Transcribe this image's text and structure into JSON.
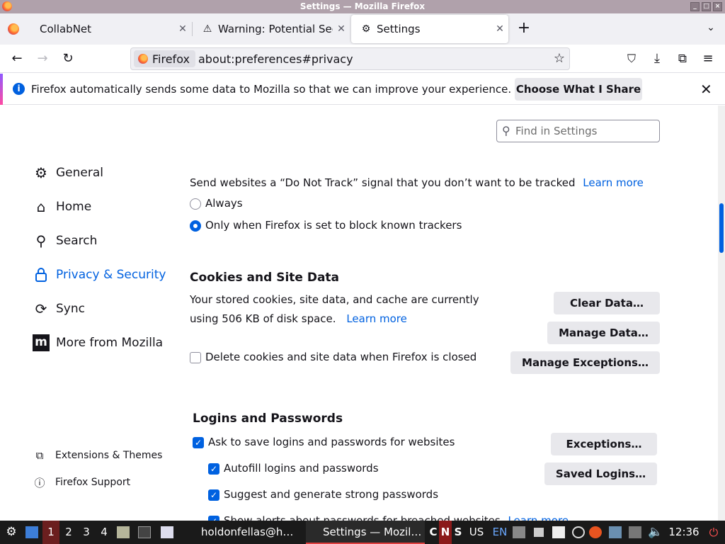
{
  "window": {
    "title": "Settings — Mozilla Firefox"
  },
  "tabs": [
    {
      "label": "CollabNet"
    },
    {
      "label": "Warning: Potential Sec"
    },
    {
      "label": "Settings"
    }
  ],
  "navbar": {
    "identity": "Firefox",
    "url": "about:preferences#privacy"
  },
  "notification": {
    "message": "Firefox automatically sends some data to Mozilla so that we can improve your experience.",
    "button": "Choose What I Share"
  },
  "search": {
    "placeholder": "Find in Settings"
  },
  "sidebar": {
    "items": [
      {
        "label": "General",
        "icon": "gear-icon"
      },
      {
        "label": "Home",
        "icon": "home-icon"
      },
      {
        "label": "Search",
        "icon": "search-icon"
      },
      {
        "label": "Privacy & Security",
        "icon": "lock-icon",
        "selected": true
      },
      {
        "label": "Sync",
        "icon": "sync-icon"
      },
      {
        "label": "More from Mozilla",
        "icon": "mozilla-icon"
      }
    ],
    "footer": [
      {
        "label": "Extensions & Themes",
        "icon": "puzzle-icon"
      },
      {
        "label": "Firefox Support",
        "icon": "help-icon"
      }
    ]
  },
  "dnt": {
    "text": "Send websites a “Do Not Track” signal that you don’t want to be tracked",
    "learn_more": "Learn more",
    "options": [
      {
        "label": "Always",
        "checked": false
      },
      {
        "label": "Only when Firefox is set to block known trackers",
        "checked": true
      }
    ]
  },
  "cookies": {
    "heading": "Cookies and Site Data",
    "line1": "Your stored cookies, site data, and cache are currently",
    "line2": "using 506 KB of disk space.",
    "learn_more": "Learn more",
    "clear_button": "Clear Data…",
    "manage_button": "Manage Data…",
    "exceptions_button": "Manage Exceptions…",
    "delete_checkbox": {
      "label": "Delete cookies and site data when Firefox is closed",
      "checked": false
    }
  },
  "logins": {
    "heading": "Logins and Passwords",
    "ask_save": {
      "label": "Ask to save logins and passwords for websites",
      "checked": true
    },
    "autofill": {
      "label": "Autofill logins and passwords",
      "checked": true
    },
    "suggest": {
      "label": "Suggest and generate strong passwords",
      "checked": true
    },
    "alerts": {
      "label": "Show alerts about passwords for breached websites",
      "checked": true
    },
    "alerts_learn_more": "Learn more",
    "exceptions_button": "Exceptions…",
    "saved_button": "Saved Logins…"
  },
  "taskbar": {
    "workspaces": [
      "1",
      "2",
      "3",
      "4"
    ],
    "tasks": [
      {
        "label": "holdonfellas@h…"
      },
      {
        "label": "Settings — Mozil…"
      }
    ],
    "indicators": [
      "C",
      "N",
      "S",
      "US",
      "EN"
    ],
    "clock": "12:36"
  },
  "colors": {
    "accent": "#0061e0",
    "titlebar": "#b0a1ab",
    "taskbar": "#1a1a1a"
  }
}
